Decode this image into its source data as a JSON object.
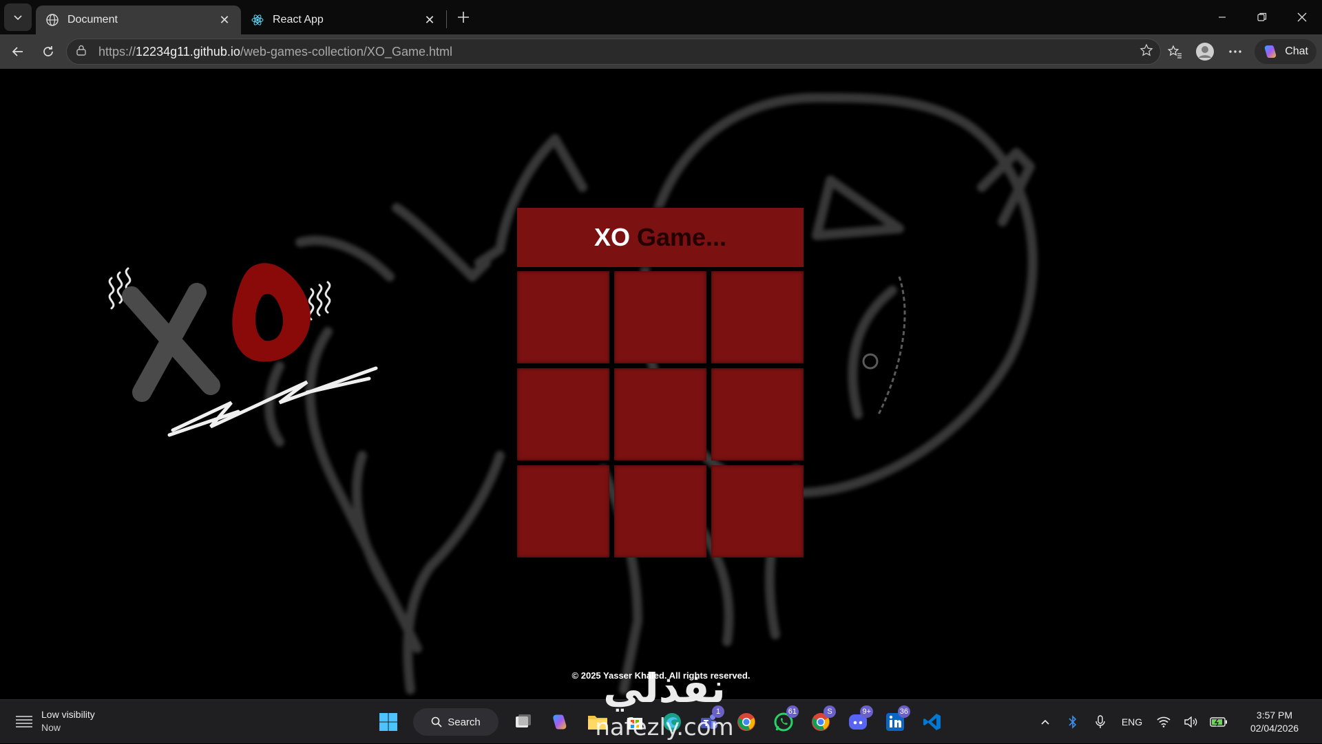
{
  "browser": {
    "tabs": [
      {
        "title": "Document",
        "icon": "globe-icon",
        "active": true
      },
      {
        "title": "React App",
        "icon": "react-icon",
        "active": false
      }
    ],
    "url_scheme": "https://",
    "url_host": "12234g11.github.io",
    "url_path": "/web-games-collection/XO_Game.html",
    "chat_label": "Chat"
  },
  "page": {
    "title_main": "XO",
    "title_rest": "Game...",
    "board_cells": [
      "",
      "",
      "",
      "",
      "",
      "",
      "",
      "",
      ""
    ],
    "footer": "© 2025 Yasser Khaled. All rights reserved.",
    "logo_text": "XO",
    "colors": {
      "board": "#7c1111",
      "title_rest": "#220000",
      "logo_o": "#8a0a0a"
    }
  },
  "taskbar": {
    "weather_title": "Low visibility",
    "weather_sub": "Now",
    "search_label": "Search",
    "badges": {
      "teams": "1",
      "whatsapp": "61",
      "chrome_profile": "S",
      "discord": "9+",
      "linkedin": "36"
    },
    "language": "ENG",
    "time": "3:57 PM",
    "date": "02/04/2026"
  },
  "watermark": {
    "text": "نفذلي",
    "site": "nafezly.com"
  }
}
